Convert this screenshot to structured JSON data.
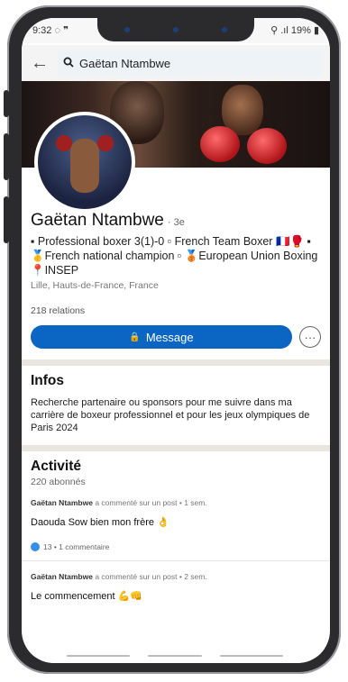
{
  "statusbar": {
    "time": "9:32",
    "left_icons": "◌ ❞",
    "battery": "19%",
    "right_icons": "⚲ .ıl"
  },
  "search": {
    "back_icon": "arrow-left-icon",
    "query": "Gaëtan Ntambwe"
  },
  "profile": {
    "name": "Gaëtan Ntambwe",
    "degree": "· 3e",
    "headline": "▪ Professional boxer 3(1)-0 ▫ French Team Boxer 🇫🇷🥊 ▪ 🥇French national champion ▫ 🥉European Union Boxing 📍INSEP",
    "location": "Lille, Hauts-de-France, France",
    "relations": "218 relations"
  },
  "actions": {
    "message_label": "Message",
    "message_icon": "🔒",
    "more_label": "···"
  },
  "about": {
    "title": "Infos",
    "text": "Recherche partenaire ou sponsors pour me suivre dans ma carrière de boxeur professionnel et pour les jeux olympiques de Paris 2024"
  },
  "activity": {
    "title": "Activité",
    "followers": "220 abonnés",
    "posts": [
      {
        "author": "Gaëtan Ntambwe",
        "meta": " a commenté sur un post • 1 sem.",
        "text": "Daouda Sow bien mon frère 👌",
        "reactions": "13 • 1 commentaire"
      },
      {
        "author": "Gaëtan Ntambwe",
        "meta": " a commenté sur un post • 2 sem.",
        "text": "Le commencement 💪👊"
      }
    ]
  },
  "colors": {
    "accent": "#0a66c2",
    "divider": "#e9e6df"
  }
}
